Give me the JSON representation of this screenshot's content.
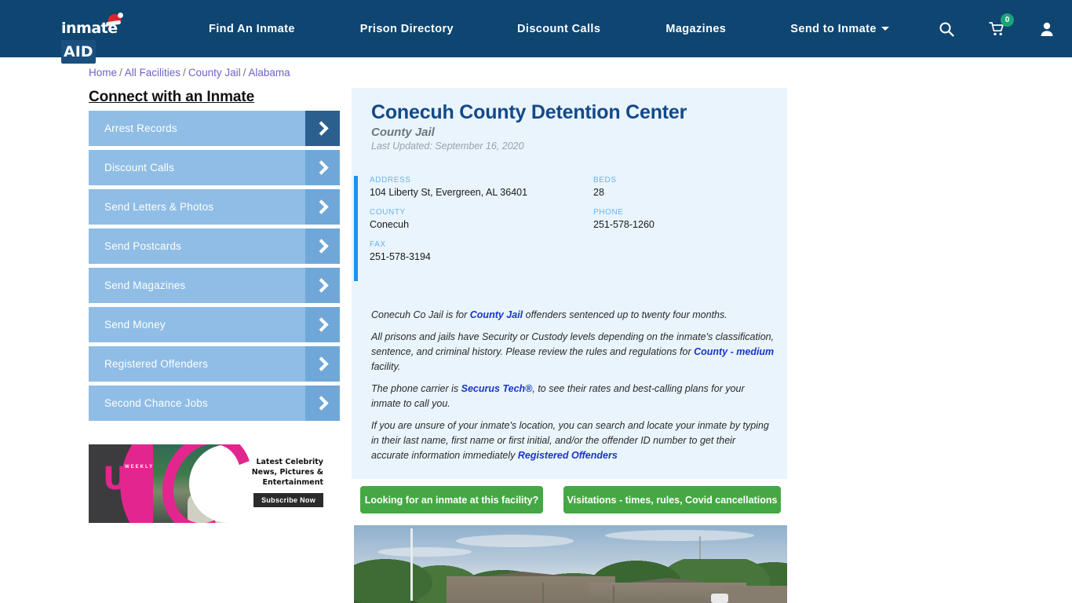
{
  "header": {
    "logo_text": "inmate",
    "logo_accent": "AID",
    "nav": [
      {
        "label": "Find An Inmate"
      },
      {
        "label": "Prison Directory"
      },
      {
        "label": "Discount Calls"
      },
      {
        "label": "Magazines"
      },
      {
        "label": "Send to Inmate"
      }
    ],
    "icons": {
      "search": "search-icon",
      "cart": "cart-icon",
      "cart_count": "0",
      "account": "user-icon"
    },
    "colors": {
      "bar": "#0e4571",
      "badge": "#1aa67b"
    }
  },
  "breadcrumb": {
    "items": [
      "Home",
      "All Facilities",
      "County Jail",
      "Alabama"
    ],
    "separator": "/"
  },
  "sidebar": {
    "title": "Connect with an Inmate",
    "items": [
      {
        "label": "Arrest Records"
      },
      {
        "label": "Discount Calls"
      },
      {
        "label": "Send Letters & Photos"
      },
      {
        "label": "Send Postcards"
      },
      {
        "label": "Send Magazines"
      },
      {
        "label": "Send Money"
      },
      {
        "label": "Registered Offenders"
      },
      {
        "label": "Second Chance Jobs"
      }
    ],
    "ad": {
      "brand": "US",
      "brand_sub": "WEEKLY",
      "copy": "Latest Celebrity News, Pictures & Entertainment",
      "cta": "Subscribe Now"
    }
  },
  "facility": {
    "name": "Conecuh County Detention Center",
    "type": "County Jail",
    "last_updated": "Last Updated: September 16, 2020",
    "info": [
      {
        "label": "ADDRESS",
        "value": "104 Liberty St, Evergreen, AL 36401"
      },
      {
        "label": "BEDS",
        "value": "28"
      },
      {
        "label": "COUNTY",
        "value": "Conecuh"
      },
      {
        "label": "PHONE",
        "value": "251-578-1260"
      },
      {
        "label": "FAX",
        "value": "251-578-3194"
      }
    ],
    "paragraphs": {
      "p1_a": "Conecuh Co Jail is for ",
      "p1_link": "County Jail",
      "p1_b": " offenders sentenced up to twenty four months.",
      "p2_a": "All prisons and jails have Security or Custody levels depending on the inmate's classification, sentence, and criminal history. Please review the rules and regulations for ",
      "p2_link": "County - medium",
      "p2_b": " facility.",
      "p3_a": "The phone carrier is ",
      "p3_link": "Securus Tech®",
      "p3_b": ", to see their rates and best-calling plans for your inmate to call you.",
      "p4_a": "If you are unsure of your inmate's location, you can search and locate your inmate by typing in their last name, first name or first initial, and/or the offender ID number to get their accurate information immediately ",
      "p4_link": "Registered Offenders"
    }
  },
  "actions": {
    "inmate_search": "Looking for an inmate at this facility?",
    "visitations": "Visitations - times, rules, Covid cancellations",
    "color": "#45a845"
  }
}
